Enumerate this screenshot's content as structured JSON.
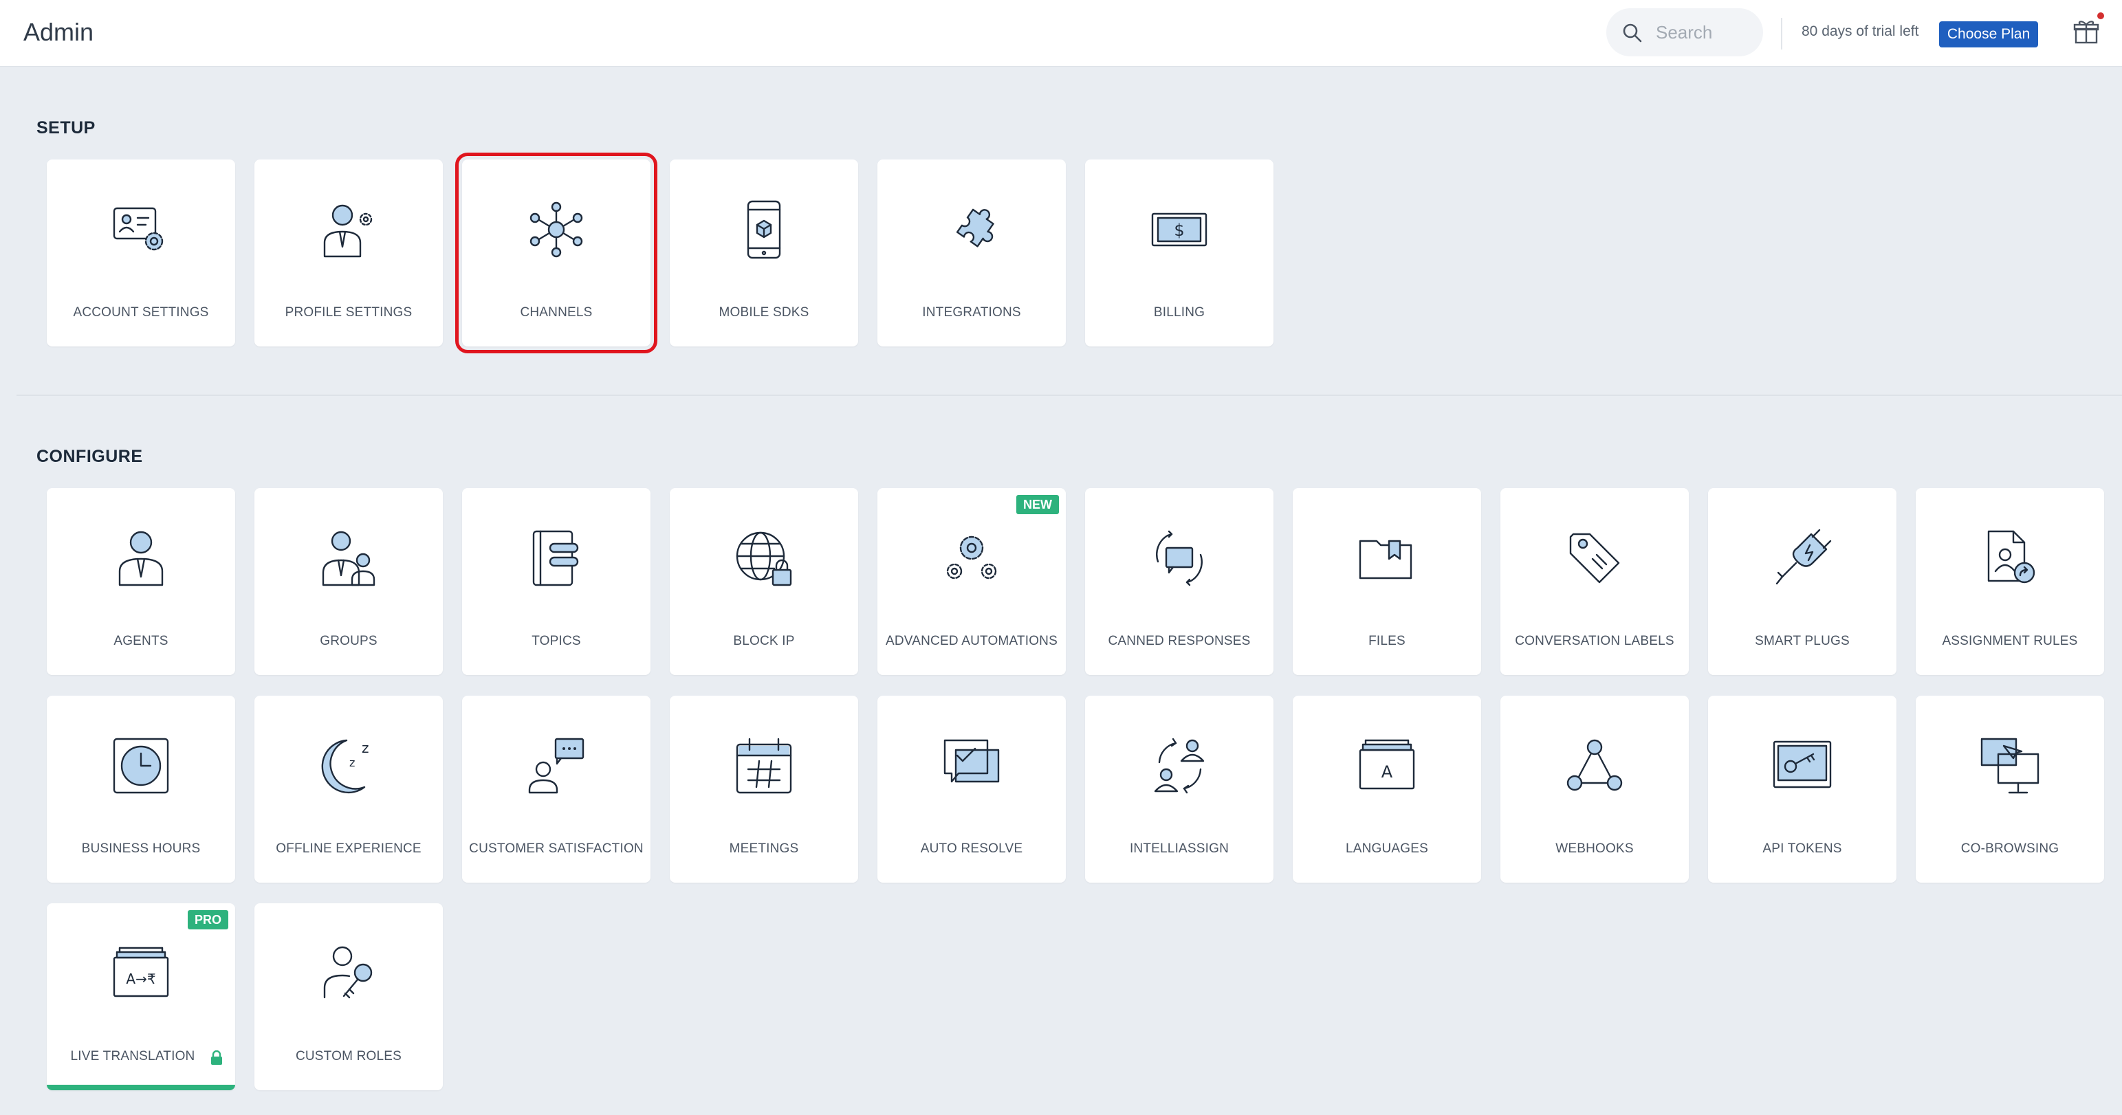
{
  "header": {
    "title": "Admin",
    "search_placeholder": "Search",
    "trial_text": "80 days of trial left",
    "choose_plan_label": "Choose Plan"
  },
  "setup": {
    "title": "SETUP",
    "items": [
      {
        "label": "ACCOUNT SETTINGS",
        "icon": "account-settings-icon"
      },
      {
        "label": "PROFILE SETTINGS",
        "icon": "profile-settings-icon"
      },
      {
        "label": "CHANNELS",
        "icon": "channels-icon",
        "selected": true
      },
      {
        "label": "MOBILE SDKS",
        "icon": "mobile-sdk-icon"
      },
      {
        "label": "INTEGRATIONS",
        "icon": "puzzle-icon"
      },
      {
        "label": "BILLING",
        "icon": "billing-icon"
      }
    ]
  },
  "configure": {
    "title": "CONFIGURE",
    "items": [
      {
        "label": "AGENTS",
        "icon": "agent-icon"
      },
      {
        "label": "GROUPS",
        "icon": "groups-icon"
      },
      {
        "label": "TOPICS",
        "icon": "topics-icon"
      },
      {
        "label": "BLOCK IP",
        "icon": "block-ip-icon"
      },
      {
        "label": "ADVANCED AUTOMATIONS",
        "icon": "automation-gears-icon",
        "badge": "NEW"
      },
      {
        "label": "CANNED RESPONSES",
        "icon": "canned-responses-icon"
      },
      {
        "label": "FILES",
        "icon": "folder-icon"
      },
      {
        "label": "CONVERSATION LABELS",
        "icon": "tag-icon"
      },
      {
        "label": "SMART PLUGS",
        "icon": "plug-icon"
      },
      {
        "label": "ASSIGNMENT RULES",
        "icon": "assignment-rules-icon"
      },
      {
        "label": "BUSINESS HOURS",
        "icon": "clock-icon"
      },
      {
        "label": "OFFLINE EXPERIENCE",
        "icon": "moon-icon"
      },
      {
        "label": "CUSTOMER SATISFACTION",
        "icon": "customer-satisfaction-icon"
      },
      {
        "label": "MEETINGS",
        "icon": "calendar-icon"
      },
      {
        "label": "AUTO RESOLVE",
        "icon": "auto-resolve-icon"
      },
      {
        "label": "INTELLIASSIGN",
        "icon": "intelliassign-icon"
      },
      {
        "label": "LANGUAGES",
        "icon": "languages-icon"
      },
      {
        "label": "WEBHOOKS",
        "icon": "webhooks-icon"
      },
      {
        "label": "API TOKENS",
        "icon": "api-key-icon"
      },
      {
        "label": "CO-BROWSING",
        "icon": "co-browsing-icon"
      },
      {
        "label": "LIVE TRANSLATION",
        "icon": "translation-icon",
        "badge": "PRO",
        "locked": true
      },
      {
        "label": "CUSTOM ROLES",
        "icon": "custom-roles-icon"
      }
    ]
  },
  "colors": {
    "accent": "#1f5fbf",
    "badge": "#2db27d",
    "selection": "#e0161f",
    "background": "#e9edf2"
  }
}
